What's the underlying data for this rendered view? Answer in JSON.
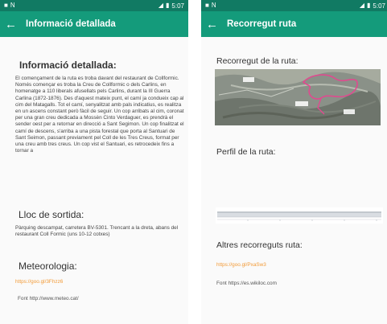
{
  "status_bar": {
    "time_left": "5:07",
    "time_right": "5:07"
  },
  "screens": {
    "detail": {
      "title": "Informació detallada",
      "heading": "Informació detallada:",
      "description": "El començament de la ruta es troba davant del restaurant de Collformic. Només començar es troba la Creu de Collformic o dels Carlins, en homenatge a 110 liberals afusellats pels Carlins, durant la III Guerra Carlina (1872-1876). Des d'aquest mateix punt, el camí ja condueix cap al cim del Matagalls. Tot el camí, senyalitzat amb pals indicatius, es realitza en un ascens constant però fàcil de seguir. Un cop arribats al cim, coronat per una gran creu dedicada a Mossèn Cinto Verdaguer, es prendrà el sender oest per a retornar en direcció a Sant Segimon. Un cop finalitzat el camí de descens, s'arriba a una pista forestal que porta al Santuari de Sant Seimon, passant previament pel Coll de les Tres Creus, format per una creu amb tres creus. Un cop vist el Santuari, es retrocedeix fins a tornar a",
      "exit_heading": "Lloc de sortida:",
      "exit_text": "Pàrquing descampat, carretera BV-5301. Trencant a la dreta, abans del restaurant Coll Formic (uns 10-12 cotxes)",
      "weather_heading": "Meteorologia:",
      "weather_link": "https://goo.gl/3Fhzz6",
      "weather_font": "Font http://www.meteo.cat/"
    },
    "route": {
      "title": "Recorregut ruta",
      "map_heading": "Recorregut de la ruta:",
      "profile_heading": "Perfil de la ruta:",
      "other_heading": "Altres recorreguts ruta:",
      "other_link": "https://goo.gl/PxaSw3",
      "other_font": "Font https://es.wikiloc.com"
    }
  },
  "colors": {
    "status_bar": "#117a63",
    "app_bar": "#149b7b",
    "link": "#f29a36"
  },
  "icons": {
    "back": "arrow-left-icon",
    "notification": "notification-icon",
    "signal": "signal-icon",
    "battery": "battery-icon"
  }
}
